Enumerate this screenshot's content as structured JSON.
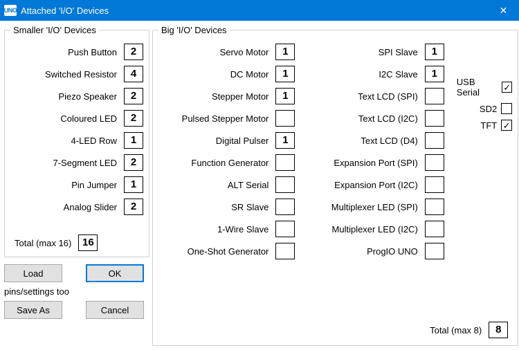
{
  "window": {
    "icon_text": "UNO",
    "title": "Attached 'I/O' Devices"
  },
  "smaller": {
    "legend": "Smaller 'I/O' Devices",
    "items": [
      {
        "label": "Push Button",
        "value": "2"
      },
      {
        "label": "Switched Resistor",
        "value": "4"
      },
      {
        "label": "Piezo Speaker",
        "value": "2"
      },
      {
        "label": "Coloured LED",
        "value": "2"
      },
      {
        "label": "4-LED Row",
        "value": "1"
      },
      {
        "label": "7-Segment LED",
        "value": "2"
      },
      {
        "label": "Pin Jumper",
        "value": "1"
      },
      {
        "label": "Analog Slider",
        "value": "2"
      }
    ],
    "total_label": "Total (max 16)",
    "total_value": "16"
  },
  "big": {
    "legend": "Big 'I/O' Devices",
    "col1": [
      {
        "label": "Servo Motor",
        "value": "1"
      },
      {
        "label": "DC Motor",
        "value": "1"
      },
      {
        "label": "Stepper Motor",
        "value": "1"
      },
      {
        "label": "Pulsed Stepper Motor",
        "value": ""
      },
      {
        "label": "Digital Pulser",
        "value": "1"
      },
      {
        "label": "Function Generator",
        "value": ""
      },
      {
        "label": "ALT Serial",
        "value": ""
      },
      {
        "label": "SR Slave",
        "value": ""
      },
      {
        "label": "1-Wire Slave",
        "value": ""
      },
      {
        "label": "One-Shot Generator",
        "value": ""
      }
    ],
    "col2": [
      {
        "label": "SPI Slave",
        "value": "1"
      },
      {
        "label": "I2C Slave",
        "value": "1"
      },
      {
        "label": "Text LCD (SPI)",
        "value": ""
      },
      {
        "label": "Text LCD (I2C)",
        "value": ""
      },
      {
        "label": "Text LCD (D4)",
        "value": ""
      },
      {
        "label": "Expansion Port (SPI)",
        "value": ""
      },
      {
        "label": "Expansion Port (I2C)",
        "value": ""
      },
      {
        "label": "Multiplexer LED (SPI)",
        "value": ""
      },
      {
        "label": "Multiplexer LED (I2C)",
        "value": ""
      },
      {
        "label": "ProgIO UNO",
        "value": ""
      }
    ],
    "checks": [
      {
        "label": "USB Serial",
        "checked": true
      },
      {
        "label": "SD2",
        "checked": false
      },
      {
        "label": "TFT",
        "checked": true
      }
    ],
    "total_label": "Total (max 8)",
    "total_value": "8"
  },
  "buttons": {
    "load": "Load",
    "ok": "OK",
    "pins": "pins/settings too",
    "save_as": "Save As",
    "cancel": "Cancel"
  }
}
